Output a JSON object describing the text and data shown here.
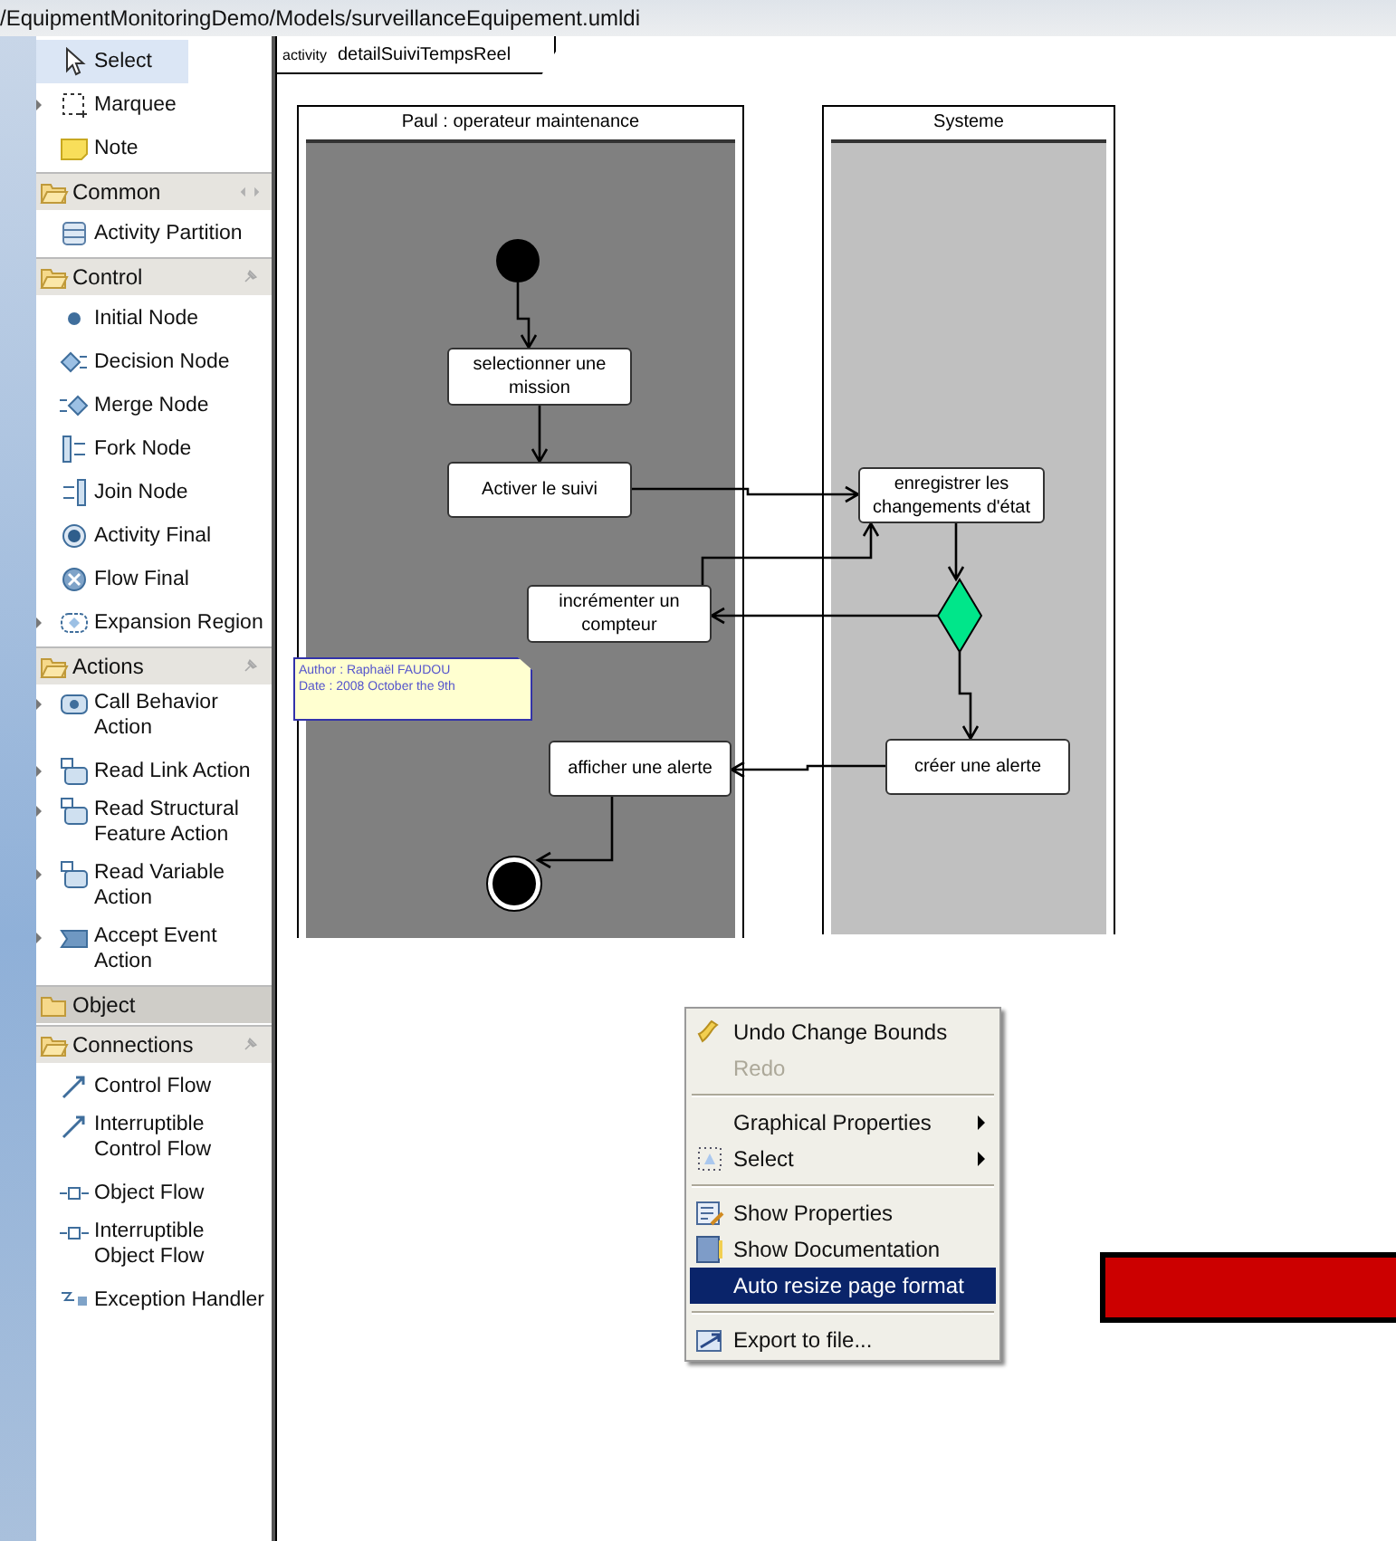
{
  "path": "/EquipmentMonitoringDemo/Models/surveillanceEquipement.umldi",
  "palette": [
    {
      "kind": "tool",
      "label": "Select",
      "selected": true,
      "submenu": false
    },
    {
      "kind": "tool",
      "label": "Marquee",
      "selected": false,
      "submenu": true
    },
    {
      "kind": "tool",
      "label": "Note",
      "selected": false,
      "submenu": false
    },
    {
      "kind": "drawer",
      "label": "Common",
      "expanded": true
    },
    {
      "kind": "tool",
      "label": "Activity Partition",
      "selected": false,
      "submenu": false
    },
    {
      "kind": "drawer",
      "label": "Control",
      "expanded": true
    },
    {
      "kind": "tool",
      "label": "Initial Node",
      "selected": false,
      "submenu": false
    },
    {
      "kind": "tool",
      "label": "Decision Node",
      "selected": false,
      "submenu": false
    },
    {
      "kind": "tool",
      "label": "Merge Node",
      "selected": false,
      "submenu": false
    },
    {
      "kind": "tool",
      "label": "Fork Node",
      "selected": false,
      "submenu": false
    },
    {
      "kind": "tool",
      "label": "Join Node",
      "selected": false,
      "submenu": false
    },
    {
      "kind": "tool",
      "label": "Activity Final",
      "selected": false,
      "submenu": false
    },
    {
      "kind": "tool",
      "label": "Flow Final",
      "selected": false,
      "submenu": false
    },
    {
      "kind": "tool",
      "label": "Expansion Region",
      "selected": false,
      "submenu": true
    },
    {
      "kind": "drawer",
      "label": "Actions",
      "expanded": true
    },
    {
      "kind": "tool",
      "label": "Call Behavior\nAction",
      "selected": false,
      "submenu": true
    },
    {
      "kind": "tool",
      "label": "Read Link Action",
      "selected": false,
      "submenu": true
    },
    {
      "kind": "tool",
      "label": "Read Structural\nFeature Action",
      "selected": false,
      "submenu": true
    },
    {
      "kind": "tool",
      "label": "Read Variable\nAction",
      "selected": false,
      "submenu": true
    },
    {
      "kind": "tool",
      "label": "Accept Event\nAction",
      "selected": false,
      "submenu": true
    },
    {
      "kind": "drawer",
      "label": "Object",
      "expanded": false
    },
    {
      "kind": "drawer",
      "label": "Connections",
      "expanded": true
    },
    {
      "kind": "tool",
      "label": "Control Flow",
      "selected": false,
      "submenu": false
    },
    {
      "kind": "tool",
      "label": "Interruptible\nControl Flow",
      "selected": false,
      "submenu": false
    },
    {
      "kind": "tool",
      "label": "Object Flow",
      "selected": false,
      "submenu": false
    },
    {
      "kind": "tool",
      "label": "Interruptible\nObject Flow",
      "selected": false,
      "submenu": false
    },
    {
      "kind": "tool",
      "label": "Exception Handler",
      "selected": false,
      "submenu": false
    }
  ],
  "diagram": {
    "frame_keyword": "activity",
    "frame_name": "detailSuiviTempsReel",
    "partitions": [
      "Paul : operateur maintenance",
      "Systeme"
    ],
    "actions": [
      "selectionner une\nmission",
      "Activer le suivi",
      "enregistrer les\nchangements d'état",
      "incrémenter un\ncompteur",
      "créer une alerte",
      "afficher une alerte"
    ],
    "note": [
      "Author : Raphaël FAUDOU",
      "Date : 2008 October the 9th"
    ]
  },
  "context_menu": [
    {
      "kind": "item",
      "label": "Undo Change Bounds",
      "disabled": false,
      "selected": false,
      "submenu": false
    },
    {
      "kind": "item",
      "label": "Redo",
      "disabled": true,
      "selected": false,
      "submenu": false
    },
    {
      "kind": "separator"
    },
    {
      "kind": "item",
      "label": "Graphical Properties",
      "disabled": false,
      "selected": false,
      "submenu": true
    },
    {
      "kind": "item",
      "label": "Select",
      "disabled": false,
      "selected": false,
      "submenu": true
    },
    {
      "kind": "separator"
    },
    {
      "kind": "item",
      "label": "Show Properties",
      "disabled": false,
      "selected": false,
      "submenu": false
    },
    {
      "kind": "item",
      "label": "Show Documentation",
      "disabled": false,
      "selected": false,
      "submenu": false
    },
    {
      "kind": "item",
      "label": "Auto resize page format",
      "disabled": false,
      "selected": true,
      "submenu": false
    },
    {
      "kind": "separator"
    },
    {
      "kind": "item",
      "label": "Export to file...",
      "disabled": false,
      "selected": false,
      "submenu": false
    }
  ]
}
